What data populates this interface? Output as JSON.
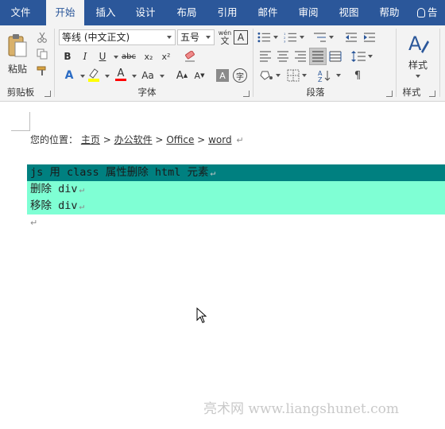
{
  "tabs": [
    {
      "label": "文件",
      "active": false
    },
    {
      "label": "开始",
      "active": true
    },
    {
      "label": "插入",
      "active": false
    },
    {
      "label": "设计",
      "active": false
    },
    {
      "label": "布局",
      "active": false
    },
    {
      "label": "引用",
      "active": false
    },
    {
      "label": "邮件",
      "active": false
    },
    {
      "label": "审阅",
      "active": false
    },
    {
      "label": "视图",
      "active": false
    },
    {
      "label": "帮助",
      "active": false
    }
  ],
  "tell_me": "告",
  "clipboard": {
    "paste_label": "粘贴",
    "group_label": "剪贴板"
  },
  "font": {
    "font_name": "等线 (中文正文)",
    "font_size": "五号",
    "phonetic_top": "wén",
    "phonetic_bottom": "文",
    "char_border": "A",
    "bold": "B",
    "italic": "I",
    "underline": "U",
    "strike": "abc",
    "subscript": "x₂",
    "superscript": "x²",
    "text_effect": "A",
    "font_color": "A",
    "change_case": "Aa",
    "grow": "A",
    "shrink": "A",
    "char_shading": "A",
    "enclose": "字",
    "group_label": "字体",
    "highlight_color": "#ffff00",
    "font_color_bar": "#ff0000"
  },
  "paragraph": {
    "group_label": "段落"
  },
  "styles": {
    "label": "样式",
    "group_label": "样式"
  },
  "document": {
    "breadcrumb": {
      "prefix": "您的位置：",
      "home": "主页",
      "sep": ">",
      "office_software": "办公软件",
      "office": "Office",
      "word": "word"
    },
    "para_mark": "↵",
    "lines": [
      {
        "text": "js 用 class 属性删除 html 元素",
        "bg": "#008080"
      },
      {
        "text": "删除 div",
        "bg": "#7fffd4"
      },
      {
        "text": "移除 div",
        "bg": "#7fffd4"
      }
    ]
  },
  "watermark": "亮术网 www.liangshunet.com",
  "colors": {
    "accent": "#2b579a",
    "ribbon_bg": "#f3f3f3"
  }
}
